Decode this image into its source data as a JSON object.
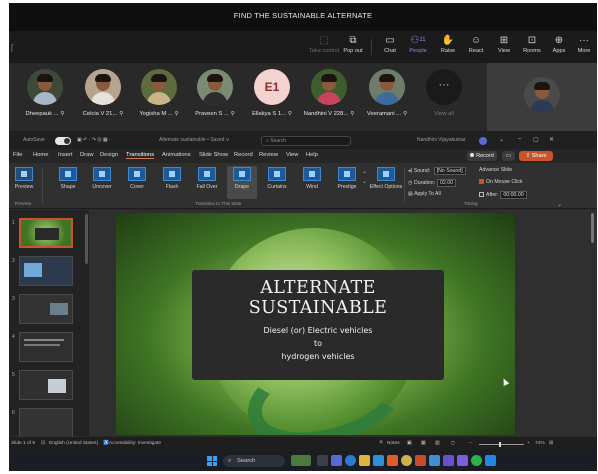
{
  "meeting": {
    "title": "FIND THE SUSTAINABLE ALTERNATE"
  },
  "toolbar": {
    "items": [
      {
        "label": "Take control",
        "icon": "take-control-icon",
        "disabled": true
      },
      {
        "label": "Pop out",
        "icon": "pop-out-icon"
      },
      {
        "label": "Chat",
        "icon": "chat-icon"
      },
      {
        "label": "People",
        "icon": "people-icon",
        "count": "11",
        "active": true
      },
      {
        "label": "Raise",
        "icon": "raise-hand-icon"
      },
      {
        "label": "React",
        "icon": "react-icon"
      },
      {
        "label": "View",
        "icon": "view-icon"
      },
      {
        "label": "Rooms",
        "icon": "rooms-icon"
      },
      {
        "label": "Apps",
        "icon": "apps-icon"
      },
      {
        "label": "More",
        "icon": "more-icon"
      }
    ]
  },
  "participants": [
    {
      "name": "Dheepauk ...",
      "kind": "photo",
      "bg": "#3d4a3a",
      "shirt": "#a9b7c8"
    },
    {
      "name": "Celcia V 21...",
      "kind": "photo",
      "bg": "#b7a48e",
      "shirt": "#e6e2dc"
    },
    {
      "name": "Yogisha M ...",
      "kind": "photo",
      "bg": "#5d6b3f",
      "shirt": "#c9b48a"
    },
    {
      "name": "Praveen S ...",
      "kind": "photo",
      "bg": "#7b8a73",
      "shirt": "#2c2c2c"
    },
    {
      "name": "Ellakya S 1...",
      "kind": "initials",
      "initials": "E1"
    },
    {
      "name": "Nandhini V 228...",
      "kind": "photo",
      "bg": "#3e5f2d",
      "shirt": "#c7445a"
    },
    {
      "name": "Veeramani ...",
      "kind": "photo",
      "bg": "#6e7d6a",
      "shirt": "#3c6b9c"
    },
    {
      "name": "View all",
      "kind": "viewall"
    }
  ],
  "ppt": {
    "titlebar": {
      "autosave": "AutoSave",
      "filename": "Alternate sustainable • Saved ∨",
      "search": "Search",
      "user": "Nandhini Vijayakumar"
    },
    "menus": [
      "File",
      "Home",
      "Insert",
      "Draw",
      "Design",
      "Transitions",
      "Animations",
      "Slide Show",
      "Record",
      "Review",
      "View",
      "Help"
    ],
    "record_label": "Record",
    "share_label": "Share",
    "ribbon": {
      "preview": "Preview",
      "transitions": [
        "Shape",
        "Uncover",
        "Cover",
        "Flash",
        "Fall Over",
        "Drape",
        "Curtains",
        "Wind",
        "Prestige"
      ],
      "effect_options": "Effect Options",
      "sound_label": "Sound:",
      "sound_value": "[No Sound]",
      "duration_label": "Duration:",
      "duration_value": "02.00",
      "apply_all": "Apply To All",
      "advance_label": "Advance Slide",
      "on_click": "On Mouse Click",
      "after_label": "After:",
      "after_value": "00:00.00",
      "group_preview": "Preview",
      "group_transition": "Transition to This Slide",
      "group_timing": "Timing"
    },
    "slide": {
      "title_line1": "ALTERNATE",
      "title_line2": "SUSTAINABLE",
      "subtitle_line1": "Diesel (or) Electric vehicles",
      "subtitle_line2": "to",
      "subtitle_line3": "hydrogen vehicles"
    },
    "status": {
      "slide_of": "Slide 1 of 9",
      "language": "English (United States)",
      "accessibility": "Accessibility: Investigate",
      "notes": "Notes",
      "zoom": "74%"
    }
  },
  "taskbar": {
    "search_placeholder": "Search"
  },
  "colors": {
    "accent": "#c9542a",
    "teams_active": "#8b8ee8",
    "initials_bg": "#f3d2d0"
  }
}
